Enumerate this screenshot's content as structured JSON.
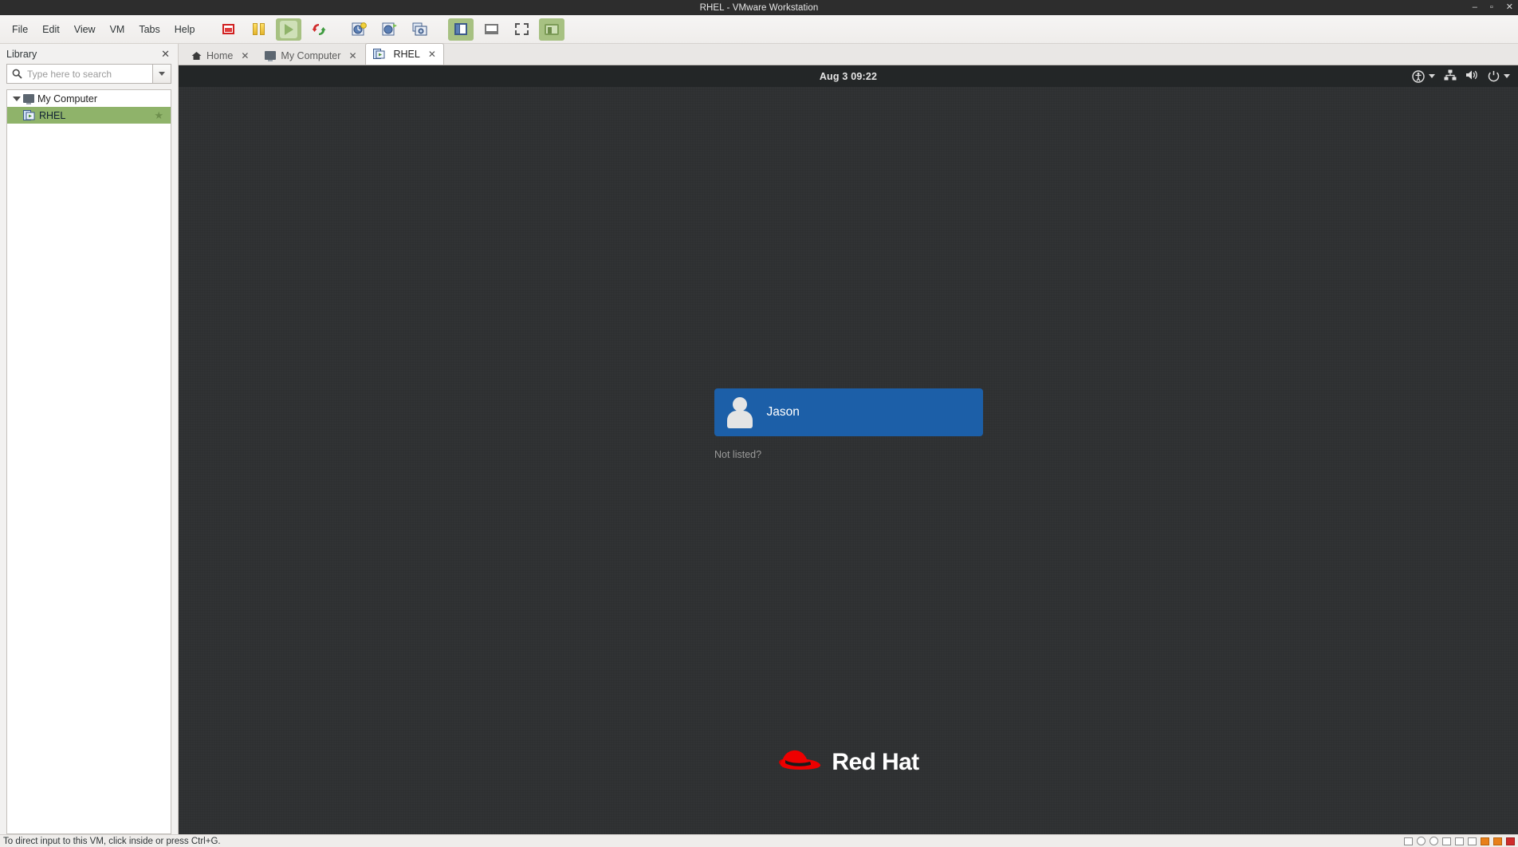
{
  "window": {
    "title": "RHEL - VMware Workstation",
    "controls": {
      "minimize": "–",
      "maximize": "▫",
      "close": "✕"
    }
  },
  "menubar": {
    "items": [
      {
        "label": "File"
      },
      {
        "label": "Edit"
      },
      {
        "label": "View"
      },
      {
        "label": "VM"
      },
      {
        "label": "Tabs"
      },
      {
        "label": "Help"
      }
    ]
  },
  "toolbar": {
    "buttons": [
      {
        "name": "power-off-button",
        "icon": "stop-icon",
        "tooltip": "Power off"
      },
      {
        "name": "suspend-button",
        "icon": "pause-icon",
        "tooltip": "Suspend"
      },
      {
        "name": "power-on-button",
        "icon": "play-icon",
        "tooltip": "Power on this virtual machine"
      },
      {
        "name": "revert-snapshot-button",
        "icon": "revert-icon",
        "tooltip": "Revert to snapshot"
      },
      {
        "name": "take-snapshot-button",
        "icon": "snapshot-clock-icon",
        "tooltip": "Take a snapshot"
      },
      {
        "name": "manage-snapshots-button",
        "icon": "snapshot-manager-icon",
        "tooltip": "Manage snapshots"
      },
      {
        "name": "snapshot-camera-button",
        "icon": "snapshot-camera-icon",
        "tooltip": "Snapshot manager"
      },
      {
        "name": "show-library-button",
        "icon": "side-panel-icon",
        "tooltip": "Show or hide the library"
      },
      {
        "name": "unity-mode-button",
        "icon": "unity-icon",
        "tooltip": "Unity mode"
      },
      {
        "name": "fullscreen-button",
        "icon": "fullscreen-icon",
        "tooltip": "Enter full screen mode"
      },
      {
        "name": "console-view-button",
        "icon": "console-view-icon",
        "tooltip": "Console view"
      }
    ]
  },
  "sidebar": {
    "title": "Library",
    "close_label": "✕",
    "search": {
      "placeholder": "Type here to search",
      "value": "",
      "icon": "search-icon"
    },
    "tree": [
      {
        "label": "My Computer",
        "icon": "monitor-icon",
        "selected": false,
        "expanded": true,
        "starred": false
      },
      {
        "label": "RHEL",
        "icon": "vm-icon",
        "selected": true,
        "expanded": false,
        "starred": true
      }
    ]
  },
  "tabs": [
    {
      "label": "Home",
      "icon": "home-icon",
      "active": false,
      "close_label": "✕"
    },
    {
      "label": "My Computer",
      "icon": "monitor-icon",
      "active": false,
      "close_label": "✕"
    },
    {
      "label": "RHEL",
      "icon": "vm-icon",
      "active": true,
      "close_label": "✕"
    }
  ],
  "guest": {
    "os": "Red Hat Enterprise Linux",
    "topbar": {
      "clock": "Aug 3  09:22",
      "accessibility_icon": "accessibility-icon",
      "network_icon": "network-wired-icon",
      "volume_icon": "volume-icon",
      "power_icon": "power-icon"
    },
    "login": {
      "user": "Jason",
      "avatar_icon": "user-avatar-icon",
      "not_listed_label": "Not listed?",
      "button_color": "#1c5fa8"
    },
    "branding": {
      "logo_text": "Red Hat",
      "logo_icon": "red-hat-fedora-icon",
      "logo_color": "#ee0000"
    },
    "background_color": "#2e3031"
  },
  "statusbar": {
    "message": "To direct input to this VM, click inside or press Ctrl+G.",
    "indicators": [
      {
        "name": "status-disk-icon",
        "type": "sq"
      },
      {
        "name": "status-cd-icon",
        "type": "r"
      },
      {
        "name": "status-floppy-icon",
        "type": "r"
      },
      {
        "name": "status-network-icon",
        "type": "net"
      },
      {
        "name": "status-usb-icon",
        "type": "sq"
      },
      {
        "name": "status-sound-icon",
        "type": "net"
      },
      {
        "name": "status-printer-icon",
        "type": "orange"
      },
      {
        "name": "status-display-icon",
        "type": "orange"
      },
      {
        "name": "status-message-icon",
        "type": "red"
      }
    ]
  },
  "theme": {
    "titlebar_bg": "#2d2d2d",
    "toolbar_bg": "#f2f1f0",
    "selection_green": "#8fb36a",
    "guest_bg": "#2e3031"
  }
}
